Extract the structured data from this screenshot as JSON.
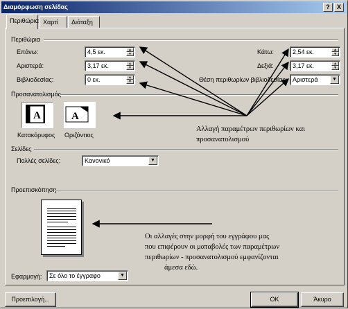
{
  "window": {
    "title": "Διαμόρφωση σελίδας",
    "help_glyph": "?",
    "close_glyph": "X"
  },
  "tabs": [
    {
      "label": "Περιθώρια",
      "active": true
    },
    {
      "label": "Χαρτί",
      "active": false
    },
    {
      "label": "Διάταξη",
      "active": false
    }
  ],
  "margins": {
    "group_label": "Περιθώρια",
    "top": {
      "label": "Επάνω:",
      "value": "4,5 εκ."
    },
    "left": {
      "label": "Αριστερά:",
      "value": "3,17 εκ."
    },
    "gutter": {
      "label": "Βιβλιοδεσίας:",
      "value": "0 εκ."
    },
    "bottom": {
      "label": "Κάτω:",
      "value": "2,54 εκ."
    },
    "right": {
      "label": "Δεξιά:",
      "value": "3,17 εκ."
    },
    "gutter_position": {
      "label": "Θέση περιθωρίων βιβλιοδεσίας:",
      "value": "Αριστερά"
    }
  },
  "orientation": {
    "group_label": "Προσανατολισμός",
    "portrait_label": "Κατακόρυφος",
    "landscape_label": "Οριζόντιος",
    "icon_letter": "A",
    "selected": "portrait"
  },
  "pages": {
    "group_label": "Σελίδες",
    "multiple_label": "Πολλές σελίδες:",
    "multiple_value": "Κανονικό"
  },
  "preview": {
    "group_label": "Προεπισκόπηση",
    "apply_label": "Εφαρμογή:",
    "apply_value": "Σε όλο το έγγραφο"
  },
  "buttons": {
    "default": "Προεπιλογή...",
    "ok": "OK",
    "cancel": "Άκυρο"
  },
  "annotations": {
    "top_line1": "Αλλαγή παραμέτρων περιθωρίων και",
    "top_line2": "προσανατολισμού",
    "bottom_line1": "Οι αλλαγές στην μορφή του εγγράφου μας",
    "bottom_line2": "που επιφέρουν οι ματαβολές των παραμέτρων",
    "bottom_line3": "περιθωρίων - προσανατολισμού εμφανίζονται",
    "bottom_line4": "άμεσα εδώ."
  },
  "colors": {
    "face": "#d4d0c8",
    "title_start": "#0a246a",
    "title_end": "#a6caf0"
  }
}
